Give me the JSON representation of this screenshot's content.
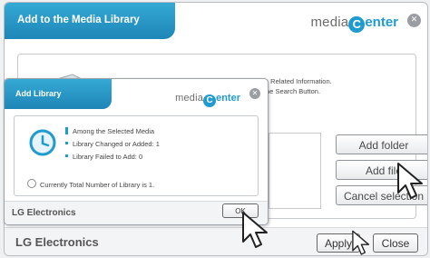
{
  "main_window": {
    "title": "Add to the Media Library",
    "logo": {
      "prefix": "media",
      "c": "C",
      "suffix": "enter"
    },
    "close_glyph": "✕",
    "info_lines": [
      "Search the Media Files in the Computer and Show the Related Information.",
      "dia, Click on the Search Button."
    ],
    "buttons": {
      "add_folder": "Add folder",
      "add_file": "Add file",
      "cancel_selection": "Cancel selection"
    },
    "footer": {
      "brand": "LG Electronics",
      "apply": "Apply",
      "close": "Close"
    }
  },
  "dialog": {
    "title": "Add Library",
    "logo": {
      "prefix": "media",
      "c": "C",
      "suffix": "enter"
    },
    "close_glyph": "✕",
    "lines": [
      "Among the Selected Media",
      "Library Changed or Added: 1",
      "Library Failed to Add: 0"
    ],
    "total_text": "Currently Total Number of Library is 1.",
    "brand": "LG Electronics",
    "ok": "OK"
  },
  "colors": {
    "accent": "#1f9bd0",
    "title_bar": "#2b9bcb",
    "text": "#4a4a4a"
  },
  "icons": [
    "pc-drive-icon",
    "clock-icon",
    "mouse-cursor-icon",
    "close-icon"
  ]
}
